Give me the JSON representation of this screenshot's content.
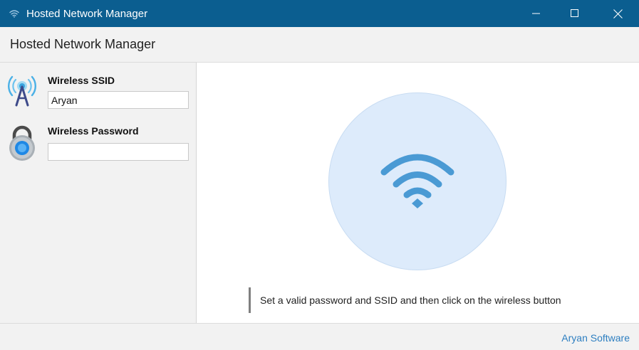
{
  "window": {
    "title": "Hosted Network Manager",
    "title_bar_color": "#0b5e90",
    "controls": [
      "minimize-icon",
      "maximize-icon",
      "close-icon"
    ]
  },
  "header": {
    "title": "Hosted Network Manager"
  },
  "sidebar": {
    "ssid": {
      "icon": "antenna-icon",
      "label": "Wireless SSID",
      "value": "Aryan"
    },
    "password": {
      "icon": "padlock-icon",
      "label": "Wireless Password",
      "value": ""
    }
  },
  "main": {
    "wifi_button_icon": "wifi-icon",
    "wifi_button_color": "#ddebfb",
    "wifi_icon_color": "#4a9ad4",
    "hint": "Set a valid password and SSID and then click on the wireless button"
  },
  "footer": {
    "vendor": "Aryan Software",
    "link_color": "#2e7fc1"
  }
}
